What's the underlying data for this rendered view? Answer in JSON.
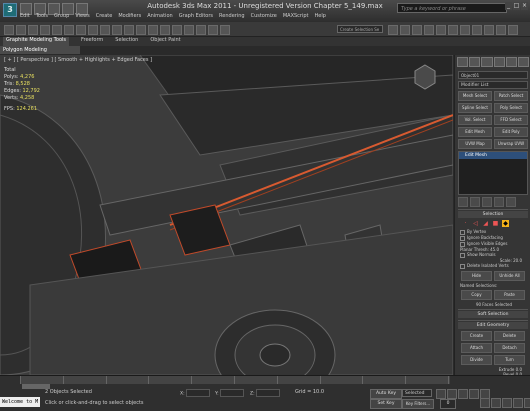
{
  "window": {
    "title": "Autodesk 3ds Max  2011   -  Unregistered Version   Chapter 5_149.max",
    "search_placeholder": "Type a keyword or phrase"
  },
  "menu": [
    "Edit",
    "Tools",
    "Group",
    "Views",
    "Create",
    "Modifiers",
    "Animation",
    "Graph Editors",
    "Rendering",
    "Customize",
    "MAXScript",
    "Help"
  ],
  "toolbar": {
    "selection_set_label": "Create Selection Se"
  },
  "ribbon": {
    "tabs": [
      "Graphite Modeling Tools",
      "Freeform",
      "Selection",
      "Object Paint"
    ],
    "active_sub": "Polygon Modeling"
  },
  "viewport": {
    "label": "[ + ] [ Perspective ] [ Smooth + Highlights + Edged Faces ]",
    "stats": [
      {
        "name": "Total",
        "value": ""
      },
      {
        "name": "Polys:",
        "value": "4,276"
      },
      {
        "name": "Tris:",
        "value": "8,528"
      },
      {
        "name": "Edges:",
        "value": "12,792"
      },
      {
        "name": "Verts:",
        "value": "4,258"
      }
    ],
    "fps_label": "FPS:",
    "fps_value": "124.261"
  },
  "command_panel": {
    "object_name": "Object01",
    "modifier_list": "Modifier List",
    "buttons": [
      "Mesh Select",
      "Patch Select",
      "Spline Select",
      "Poly Select",
      "Vol. Select",
      "FFD Select",
      "Edit Mesh",
      "Edit Poly",
      "UVW Map",
      "Unwrap UVW"
    ],
    "stack_item": "Edit Mesh",
    "selection": {
      "title": "Selection",
      "options": [
        "By Vertex",
        "Ignore Backfacing",
        "Ignore Visible Edges"
      ],
      "planar_thresh_label": "Planar Thresh:",
      "planar_thresh_value": "45.0",
      "show_normals": "Show Normals",
      "scale_label": "Scale:",
      "scale_value": "20.0",
      "delete_isolated": "Delete Isolated Verts",
      "hide": "Hide",
      "unhide_all": "Unhide All",
      "named_selections": "Named Selections:",
      "copy": "Copy",
      "paste": "Paste",
      "faces_selected": "90 Faces Selected"
    },
    "soft_selection": "Soft Selection",
    "edit_geometry": {
      "title": "Edit Geometry",
      "buttons": [
        "Create",
        "Delete",
        "Attach",
        "Detach",
        "Divide",
        "Turn"
      ],
      "extrude_label": "Extrude",
      "extrude_value": "0.0",
      "bevel_label": "Bevel",
      "bevel_value": "0.0"
    }
  },
  "status": {
    "maxscript": "Welcome to M",
    "objects_selected": "2 Objects Selected",
    "prompt": "Click or click-and-drag to select objects",
    "x_label": "X:",
    "y_label": "Y:",
    "z_label": "Z:",
    "grid": "Grid = 10.0",
    "auto_key": "Auto Key",
    "set_key": "Set Key",
    "selected": "Selected",
    "key_filters": "Key Filters...",
    "frame": "0",
    "timeline_ticks": [
      "0",
      "10",
      "20",
      "30",
      "40",
      "50",
      "60",
      "70",
      "80",
      "90",
      "100"
    ]
  },
  "colors": {
    "accent_orange": "#e07020",
    "selection_red": "#d84040",
    "stack_blue": "#2d4f7a"
  }
}
